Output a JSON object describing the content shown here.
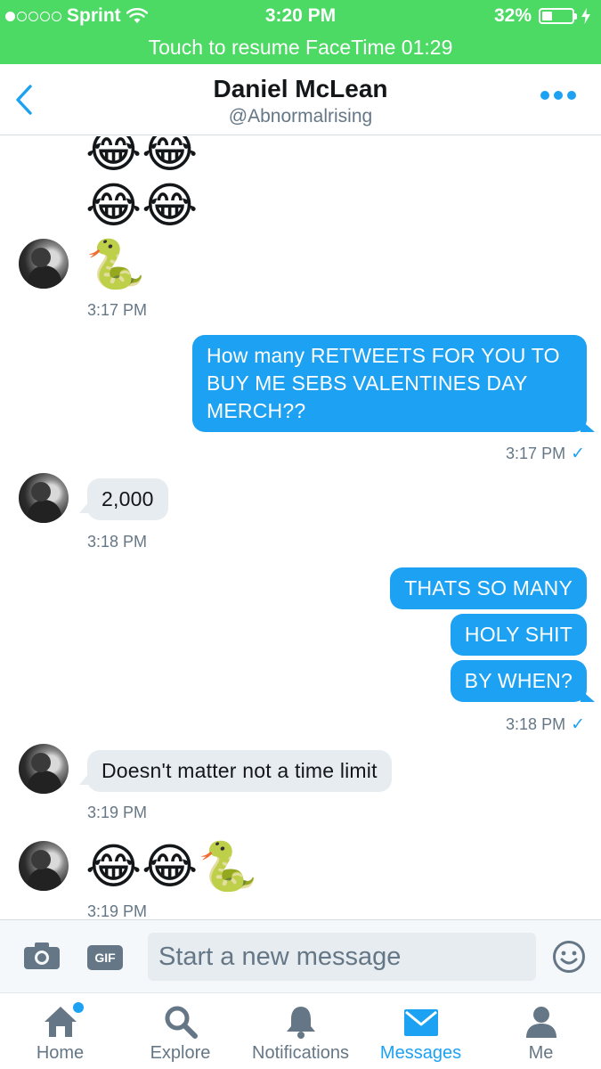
{
  "status_bar": {
    "carrier": "Sprint",
    "time": "3:20 PM",
    "battery": "32%",
    "signal_bars": 1,
    "battery_level": 0.32
  },
  "facetime_banner": "Touch to resume FaceTime 01:29",
  "header": {
    "name": "Daniel McLean",
    "handle": "@Abnormalrising"
  },
  "messages": {
    "emoji_row_top_1": "😂😂",
    "emoji_row_top_2": "😂😂",
    "snake_1": "🐍",
    "ts_1": "3:17 PM",
    "out_1": "How many RETWEETS FOR YOU TO BUY ME SEBS VALENTINES DAY MERCH??",
    "ts_2": "3:17 PM",
    "in_1": "2,000",
    "ts_3": "3:18 PM",
    "out_2": "THATS SO MANY",
    "out_3": "HOLY SHIT",
    "out_4": "BY WHEN?",
    "ts_4": "3:18 PM",
    "in_2": "Doesn't matter not a time limit",
    "ts_5": "3:19 PM",
    "emoji_row_bottom": "😂😂🐍",
    "ts_6": "3:19 PM",
    "read_check": "✓"
  },
  "composer": {
    "gif_label": "GIF",
    "placeholder": "Start a new message"
  },
  "tabs": [
    {
      "label": "Home",
      "icon": "home-icon"
    },
    {
      "label": "Explore",
      "icon": "search-icon"
    },
    {
      "label": "Notifications",
      "icon": "bell-icon"
    },
    {
      "label": "Messages",
      "icon": "envelope-icon"
    },
    {
      "label": "Me",
      "icon": "person-icon"
    }
  ],
  "colors": {
    "status_green": "#4cd964",
    "accent_blue": "#1da1f2",
    "incoming_bubble": "#e6ecf0",
    "muted_text": "#657786"
  }
}
